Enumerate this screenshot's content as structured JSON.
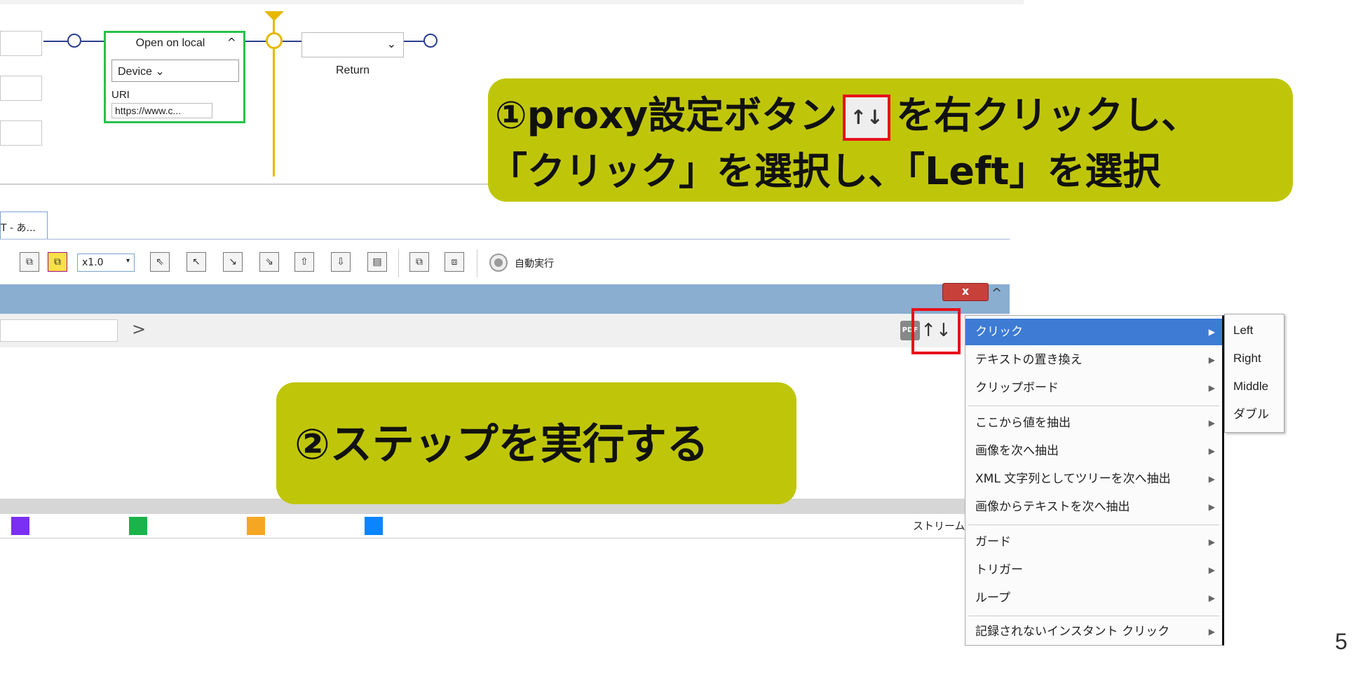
{
  "flow": {
    "step_title": "Open on local",
    "step_caret": "^",
    "device_label": "Device ⌄",
    "uri_label": "URI",
    "uri_value": "https://www.c...",
    "return_select_caret": "⌄",
    "return_label": "Return"
  },
  "callouts": {
    "step1_part1": "①proxy設定ボタン",
    "step1_icon": "↑↓",
    "step1_part2": "を右クリックし、",
    "step1_line2": "「クリック」を選択し、「Left」を選択",
    "step2": "②ステップを実行する"
  },
  "panel": {
    "tab_label": "T - あ...",
    "zoom_value": "x1.0",
    "zoom_caret": "▾",
    "auto_run_label": "自動実行",
    "close_label": "x",
    "scroll_up": "^",
    "addr_arrow": ">",
    "pdf_icon_text": "PDF",
    "proxy_icon": "↑↓",
    "stream_label": "ストリーム",
    "swatch_colors": [
      "#7b2ff2",
      "#1bb34a",
      "#f5a623",
      "#0a84ff"
    ]
  },
  "context_menu": {
    "items": [
      {
        "label": "クリック",
        "arrow": "▶",
        "selected": true
      },
      {
        "label": "テキストの置き換え",
        "arrow": "▶"
      },
      {
        "label": "クリップボード",
        "arrow": "▶"
      },
      {
        "label": "ここから値を抽出",
        "arrow": "▶"
      },
      {
        "label": "画像を次へ抽出",
        "arrow": "▶"
      },
      {
        "label": "XML 文字列としてツリーを次へ抽出",
        "arrow": "▶"
      },
      {
        "label": "画像からテキストを次へ抽出",
        "arrow": "▶"
      },
      {
        "label": "ガード",
        "arrow": "▶"
      },
      {
        "label": "トリガー",
        "arrow": "▶"
      },
      {
        "label": "ループ",
        "arrow": "▶"
      },
      {
        "label": "記録されないインスタント クリック",
        "arrow": "▶"
      }
    ],
    "submenu": [
      "Left",
      "Right",
      "Middle",
      "ダブル"
    ]
  },
  "page_number": "5",
  "colors": {
    "callout_bg": "#bfc60a",
    "highlight_red": "#e8101a",
    "menu_selected": "#3d7bd4",
    "step_border": "#27c24a",
    "trigger_yellow": "#e6b800"
  }
}
